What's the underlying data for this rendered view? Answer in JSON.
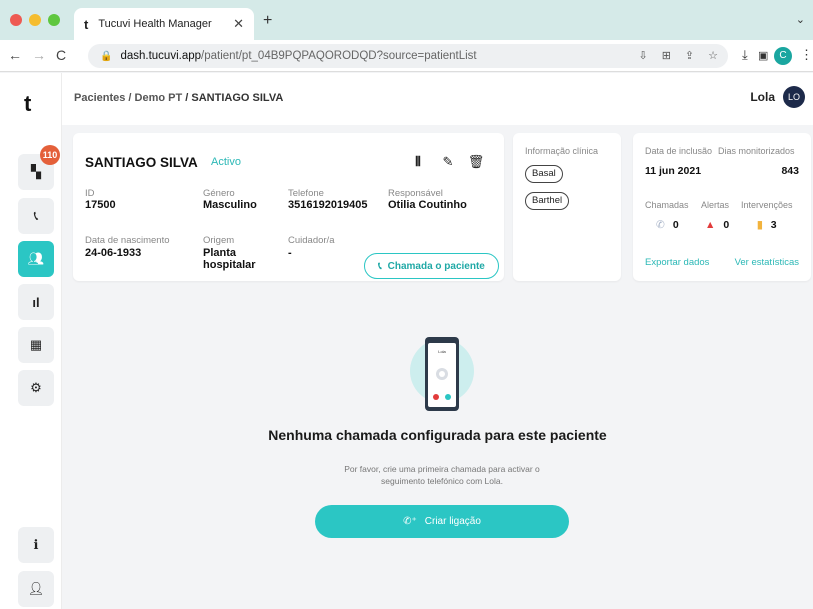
{
  "browser": {
    "tab_title": "Tucuvi Health Manager",
    "tab_logo": "t",
    "url_host": "dash.tucuvi.app",
    "url_path": "/patient/pt_04B9PQPAQORODQD?source=patientList",
    "profile_initial": "C"
  },
  "app": {
    "logo": "t",
    "notification_count": "110"
  },
  "header": {
    "breadcrumb_root": "Pacientes",
    "breadcrumb_sep": " / ",
    "breadcrumb_mid": "Demo PT",
    "breadcrumb_current": "SANTIAGO SILVA",
    "user_name": "Lola",
    "user_initials": "LO"
  },
  "patient": {
    "name": "SANTIAGO SILVA",
    "status": "Activo",
    "fields": {
      "id_label": "ID",
      "id_value": "17500",
      "gender_label": "Género",
      "gender_value": "Masculino",
      "phone_label": "Telefone",
      "phone_value": "3516192019405",
      "responsible_label": "Responsável",
      "responsible_value": "Otilia Coutinho",
      "dob_label": "Data de nascimento",
      "dob_value": "24-06-1933",
      "origin_label": "Origem",
      "origin_value": "Planta hospitalar",
      "caregiver_label": "Cuidador/a",
      "caregiver_value": "-"
    },
    "call_button": "Chamada o paciente"
  },
  "clinical": {
    "title": "Informação clínica",
    "chips": [
      "Basal",
      "Barthel"
    ]
  },
  "stats": {
    "inclusion_label": "Data de inclusão",
    "inclusion_value": "11 jun 2021",
    "monitored_label": "Dias monitorizados",
    "monitored_value": "843",
    "calls_label": "Chamadas",
    "calls_value": "0",
    "alerts_label": "Alertas",
    "alerts_value": "0",
    "interventions_label": "Intervenções",
    "interventions_value": "3",
    "export_link": "Exportar dados",
    "stats_link": "Ver estatísticas"
  },
  "empty_state": {
    "title": "Nenhuma chamada configurada para este paciente",
    "subtitle": "Por favor, crie uma primeira chamada para activar o seguimento telefónico com Lola.",
    "button": "Criar ligação",
    "phone_screen_name": "Lola"
  },
  "colors": {
    "accent": "#2bc6c4",
    "badge": "#e4603a",
    "alert": "#e23b3b",
    "intervention": "#f2b33d"
  }
}
